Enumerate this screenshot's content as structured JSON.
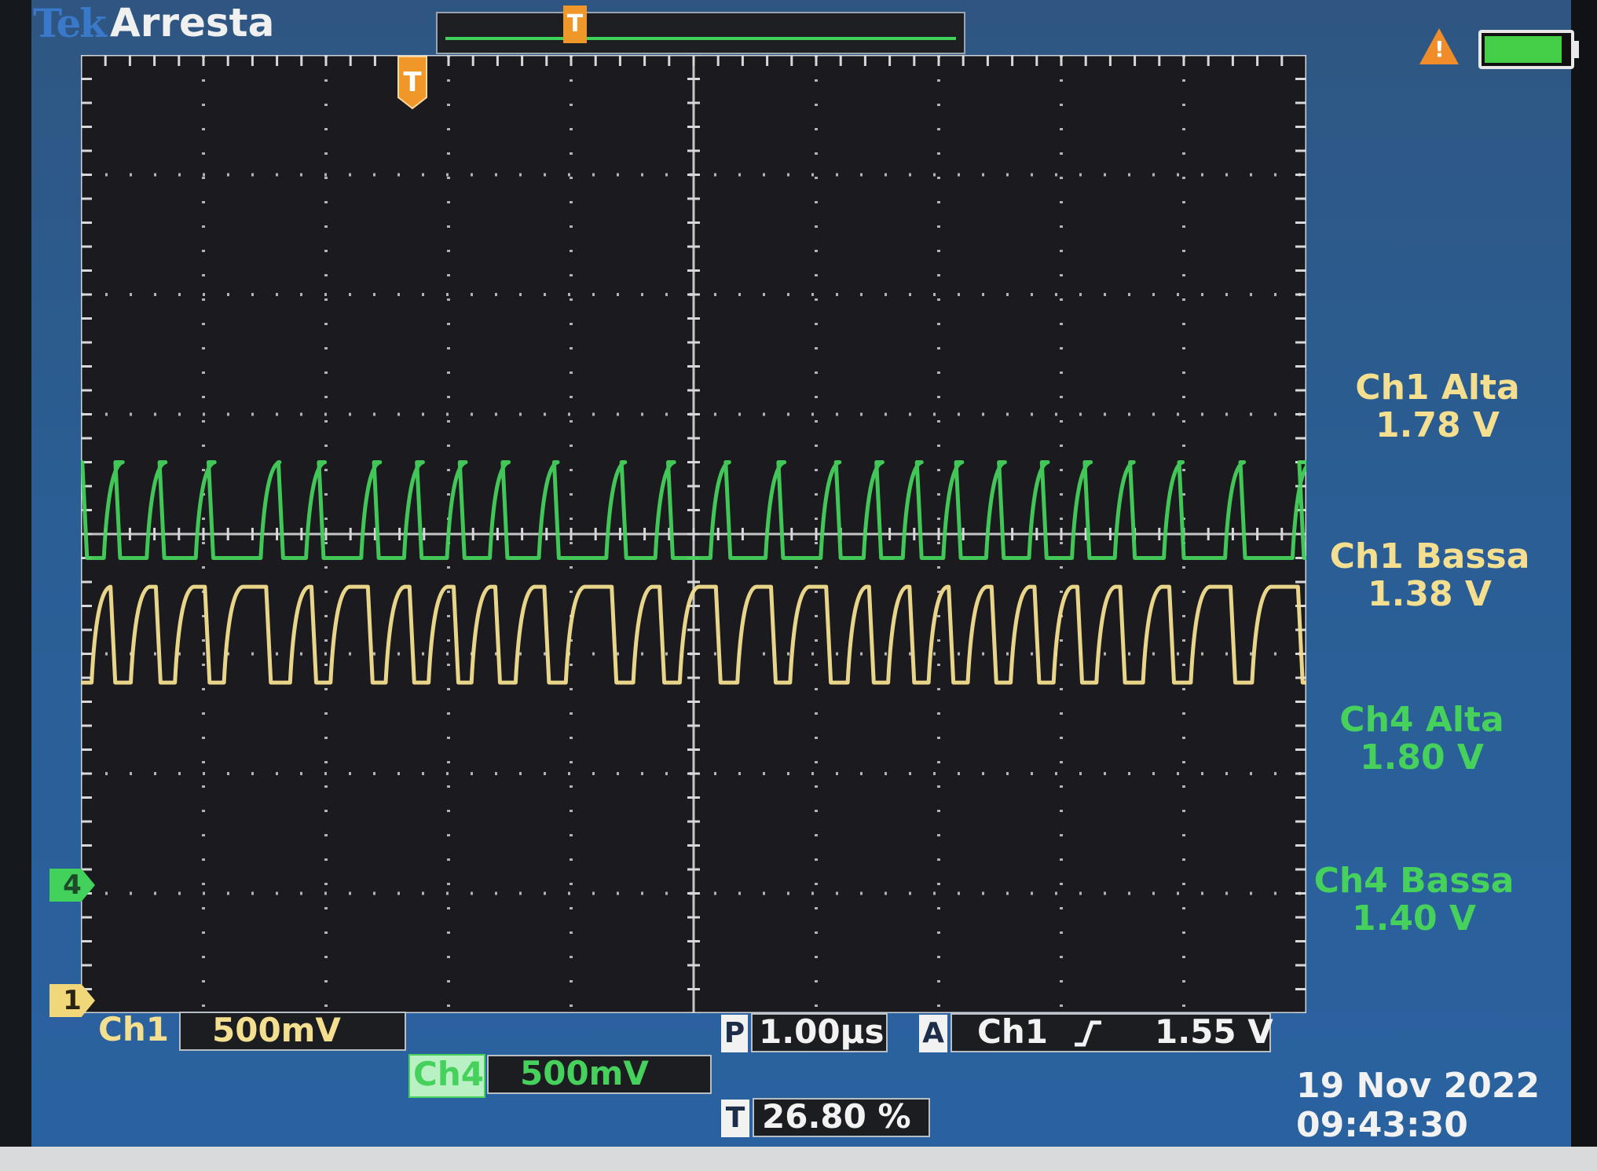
{
  "header": {
    "brand": "Tek",
    "status": "Arresta"
  },
  "trigger": {
    "marker_label": "T",
    "position_percent": 26.8,
    "position_text": "26.80 %"
  },
  "measurements": [
    {
      "label": "Ch1 Alta",
      "value": "1.78 V",
      "channel": "ch1"
    },
    {
      "label": "Ch1 Bassa",
      "value": "1.38 V",
      "channel": "ch1"
    },
    {
      "label": "Ch4 Alta",
      "value": "1.80 V",
      "channel": "ch4"
    },
    {
      "label": "Ch4 Bassa",
      "value": "1.40 V",
      "channel": "ch4"
    }
  ],
  "channels": {
    "ch1": {
      "label": "Ch1",
      "scale": "500mV",
      "marker": "1",
      "color": "#f3df8f"
    },
    "ch4": {
      "label": "Ch4",
      "scale": "500mV",
      "marker": "4",
      "color": "#46d05c"
    }
  },
  "timebase": {
    "badge": "P",
    "value": "1.00µs"
  },
  "trigger_setup": {
    "badge": "A",
    "source": "Ch1",
    "slope": "rising-edge-icon",
    "level": "1.55 V"
  },
  "datetime": {
    "date": "19 Nov 2022",
    "time": "09:43:30"
  },
  "colors": {
    "grid": "#d8d8d8",
    "plot_bg": "#1a1a1f",
    "accent": "#f0972a"
  },
  "chart_data": {
    "type": "line",
    "grid": true,
    "divisions": {
      "x": 10,
      "y": 8
    },
    "x_unit": "µs",
    "x_per_div": 1.0,
    "xlim": [
      0,
      10
    ],
    "ylim": [
      0,
      8
    ],
    "series": [
      {
        "name": "Ch4",
        "color": "#46d05c",
        "marker_div": 1.0,
        "volts_per_div": 0.5,
        "high": 1.8,
        "low": 1.4,
        "edges_us": [
          0.05,
          0.2,
          0.32,
          0.55,
          0.68,
          0.95,
          1.08,
          1.48,
          1.65,
          1.85,
          1.98,
          2.3,
          2.43,
          2.65,
          2.78,
          3.0,
          3.13,
          3.35,
          3.48,
          3.75,
          3.9,
          4.3,
          4.45,
          4.7,
          4.83,
          5.15,
          5.3,
          5.6,
          5.73,
          6.05,
          6.2,
          6.4,
          6.53,
          6.72,
          6.86,
          7.05,
          7.18,
          7.4,
          7.53,
          7.75,
          7.88,
          8.1,
          8.23,
          8.45,
          8.6,
          8.85,
          9.0,
          9.35,
          9.5,
          9.9,
          9.98
        ],
        "start_high": true
      },
      {
        "name": "Ch1",
        "color": "#f3df8f",
        "marker_div": 0.0,
        "volts_per_div": 0.5,
        "high": 1.78,
        "low": 1.38,
        "edges_us": [
          0.1,
          0.28,
          0.42,
          0.65,
          0.78,
          1.05,
          1.18,
          1.55,
          1.72,
          1.92,
          2.05,
          2.38,
          2.5,
          2.72,
          2.85,
          3.08,
          3.2,
          3.42,
          3.56,
          3.82,
          3.97,
          4.37,
          4.52,
          4.76,
          4.9,
          5.22,
          5.37,
          5.67,
          5.8,
          6.12,
          6.27,
          6.47,
          6.6,
          6.8,
          6.93,
          7.12,
          7.25,
          7.47,
          7.6,
          7.82,
          7.95,
          8.17,
          8.3,
          8.52,
          8.68,
          8.92,
          9.07,
          9.42,
          9.57,
          9.97
        ],
        "start_high": false
      }
    ]
  }
}
